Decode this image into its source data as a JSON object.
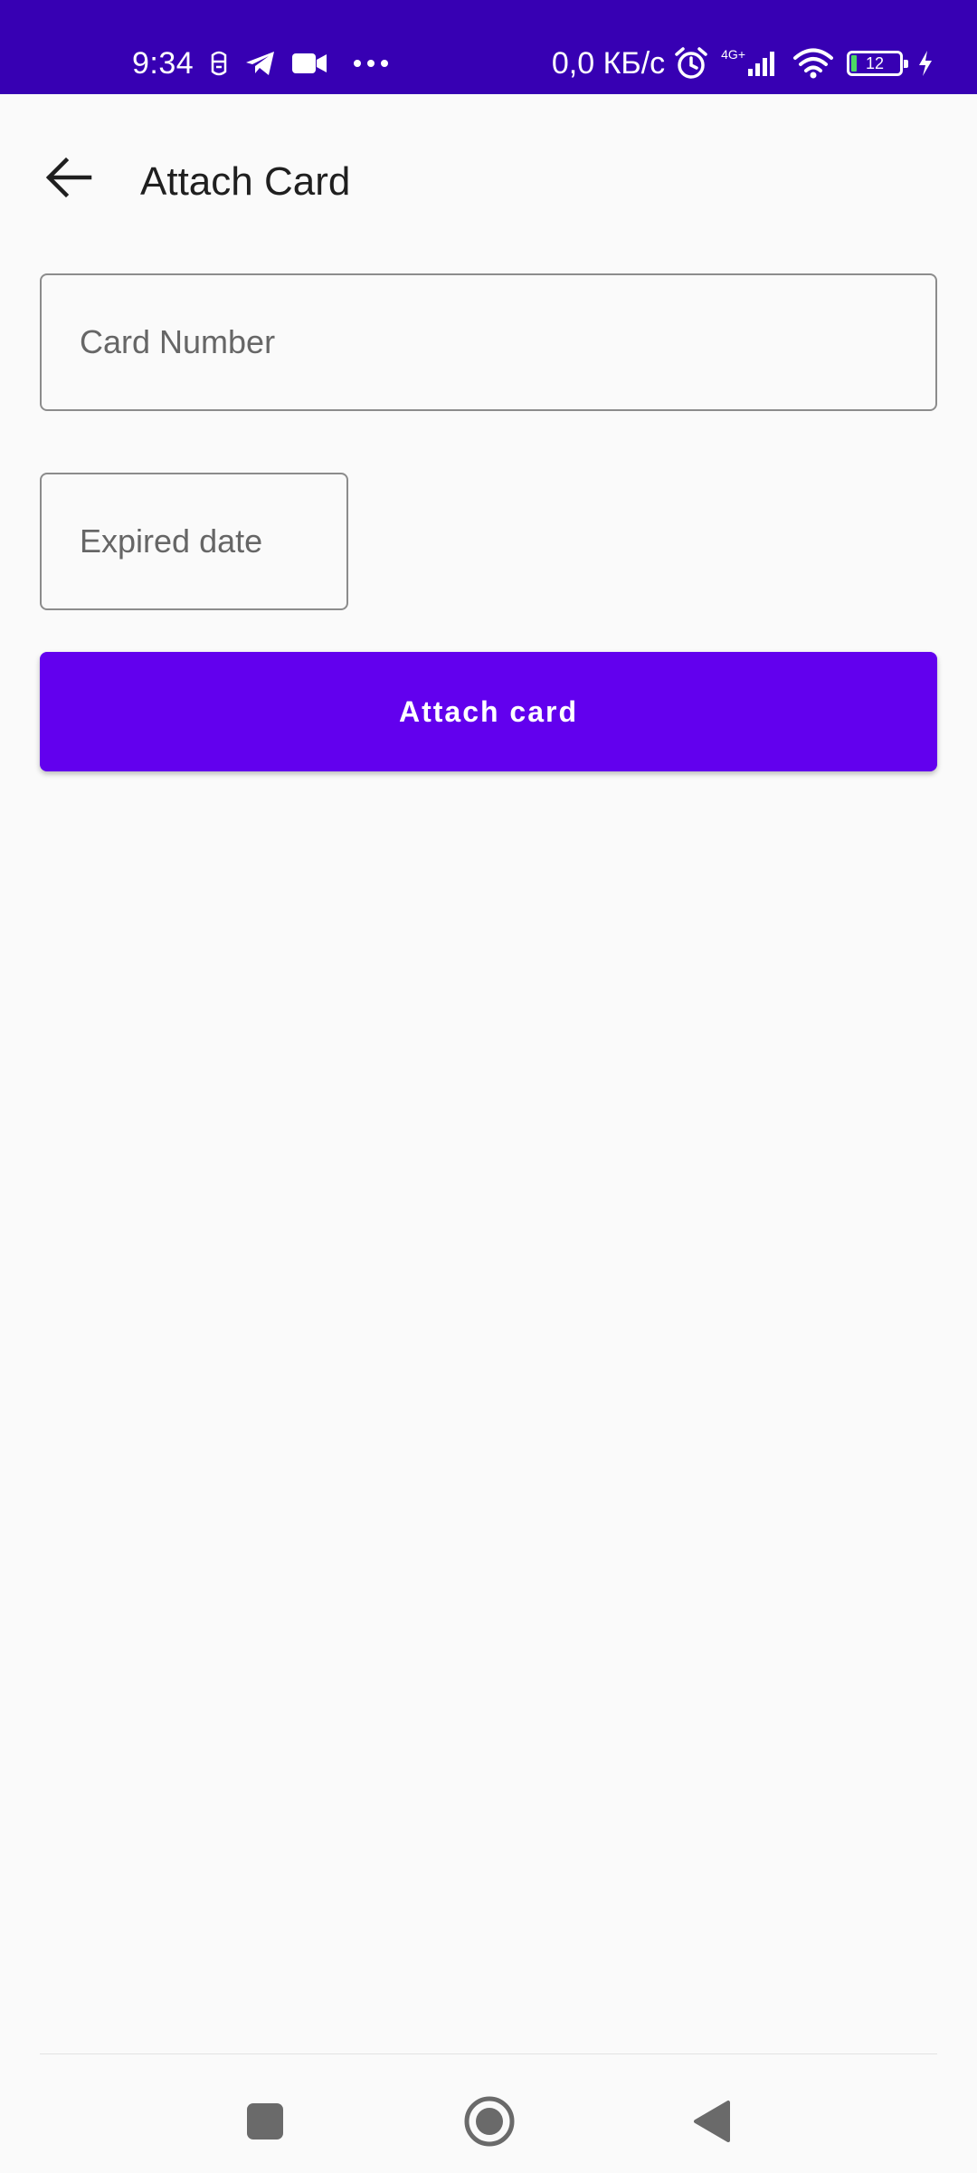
{
  "status_bar": {
    "time": "9:34",
    "speed": "0,0 КБ/с",
    "network_type": "4G+",
    "battery_level": "12",
    "icons": [
      "notification-icon",
      "telegram-icon",
      "video-camera-icon",
      "more-dots-icon",
      "alarm-icon",
      "signal-icon",
      "wifi-icon",
      "battery-icon",
      "charging-icon"
    ],
    "background_color": "#3700b3"
  },
  "app_bar": {
    "title": "Attach Card",
    "back_icon": "arrow-back-icon"
  },
  "form": {
    "card_number": {
      "placeholder": "Card Number",
      "value": ""
    },
    "expiry_date": {
      "placeholder": "Expired date",
      "value": ""
    },
    "submit_label": "Attach card",
    "accent_color": "#6200ee"
  },
  "nav_bar": {
    "icons": [
      "recents-square-icon",
      "home-circle-icon",
      "back-triangle-icon"
    ]
  }
}
